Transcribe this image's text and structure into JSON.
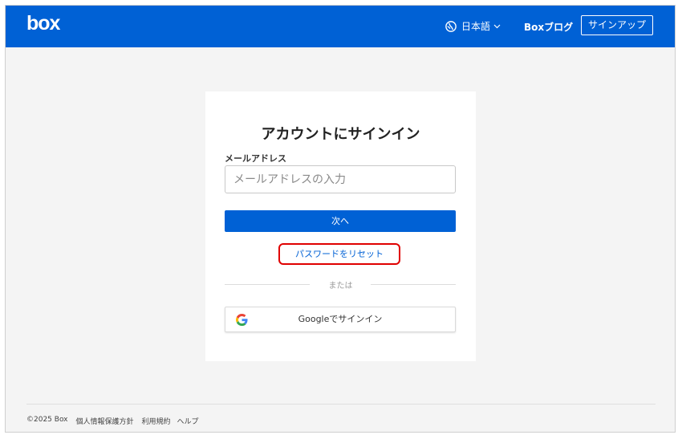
{
  "header": {
    "logo_text": "box",
    "language_label": "日本語",
    "language_icon": "globe-icon",
    "chevron_icon": "chevron-down-icon",
    "blog_label": "Boxブログ",
    "signup_label": "サインアップ",
    "background": "#0061d5"
  },
  "login": {
    "title": "アカウントにサインイン",
    "email_label": "メールアドレス",
    "email_placeholder": "メールアドレスの入力",
    "email_value": "",
    "next_label": "次へ",
    "reset_password_label": "パスワードをリセット",
    "or_label": "または",
    "google_label": "Googleでサインイン",
    "google_icon": "google-icon",
    "highlight_color": "#e00000"
  },
  "footer": {
    "copyright": "©2025 Box",
    "privacy_label": "個人情報保護方針",
    "terms_label": "利用規約",
    "help_label": "ヘルプ"
  }
}
